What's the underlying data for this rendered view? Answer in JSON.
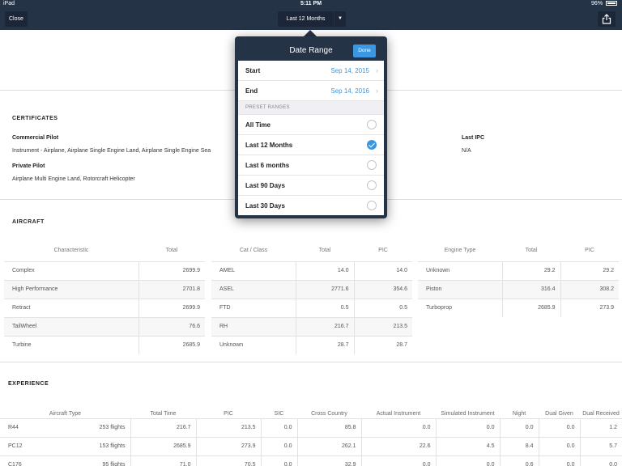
{
  "status": {
    "device": "iPad",
    "time": "5:11 PM",
    "battery": "96%"
  },
  "nav": {
    "close_label": "Close",
    "range_label": "Last 12 Months"
  },
  "certificates": {
    "title": "CERTIFICATES",
    "commercial": {
      "label": "Commercial Pilot",
      "detail": "Instrument - Airplane, Airplane Single Engine Land, Airplane Single Engine Sea"
    },
    "private": {
      "label": "Private Pilot",
      "detail": "Airplane Multi Engine Land, Rotorcraft Helicopter"
    },
    "last_ipc": {
      "label": "Last IPC",
      "value": "N/A"
    }
  },
  "aircraft": {
    "title": "AIRCRAFT",
    "characteristic": {
      "headers": [
        "Characteristic",
        "Total"
      ],
      "rows": [
        [
          "Complex",
          "2699.9"
        ],
        [
          "High Performance",
          "2701.8"
        ],
        [
          "Retract",
          "2699.9"
        ],
        [
          "TailWheel",
          "76.6"
        ],
        [
          "Turbine",
          "2685.9"
        ]
      ]
    },
    "cat_class": {
      "headers": [
        "Cat / Class",
        "Total",
        "PIC"
      ],
      "rows": [
        [
          "AMEL",
          "14.0",
          "14.0"
        ],
        [
          "ASEL",
          "2771.6",
          "354.6"
        ],
        [
          "FTD",
          "0.5",
          "0.5"
        ],
        [
          "RH",
          "216.7",
          "213.5"
        ],
        [
          "Unknown",
          "28.7",
          "28.7"
        ]
      ]
    },
    "engine_type": {
      "headers": [
        "Engine Type",
        "Total",
        "PIC"
      ],
      "rows": [
        [
          "Unknown",
          "29.2",
          "29.2"
        ],
        [
          "Piston",
          "316.4",
          "308.2"
        ],
        [
          "Turboprop",
          "2685.9",
          "273.9"
        ]
      ]
    }
  },
  "experience": {
    "title": "EXPERIENCE",
    "headers": [
      "Aircraft Type",
      "Total Time",
      "PIC",
      "SIC",
      "Cross Country",
      "Actual Instrument",
      "Simulated Instrument",
      "Night",
      "Dual Given",
      "Dual Received"
    ],
    "rows": [
      [
        "R44",
        "253 flights",
        "216.7",
        "213.5",
        "0.0",
        "85.8",
        "0.0",
        "0.0",
        "0.0",
        "0.0",
        "1.2"
      ],
      [
        "PC12",
        "153 flights",
        "2685.9",
        "273.9",
        "0.0",
        "262.1",
        "22.6",
        "4.5",
        "8.4",
        "0.0",
        "5.7"
      ],
      [
        "C176",
        "95 flights",
        "71.0",
        "70.5",
        "0.0",
        "32.9",
        "0.0",
        "0.0",
        "0.6",
        "0.0",
        "0.0"
      ]
    ]
  },
  "popover": {
    "title": "Date Range",
    "done_label": "Done",
    "start": {
      "label": "Start",
      "value": "Sep 14, 2015"
    },
    "end": {
      "label": "End",
      "value": "Sep 14, 2016"
    },
    "preset_header": "PRESET RANGES",
    "options": [
      {
        "label": "All Time",
        "selected": false
      },
      {
        "label": "Last 12 Months",
        "selected": true
      },
      {
        "label": "Last 6 months",
        "selected": false
      },
      {
        "label": "Last 90 Days",
        "selected": false
      },
      {
        "label": "Last 30 Days",
        "selected": false
      }
    ]
  }
}
